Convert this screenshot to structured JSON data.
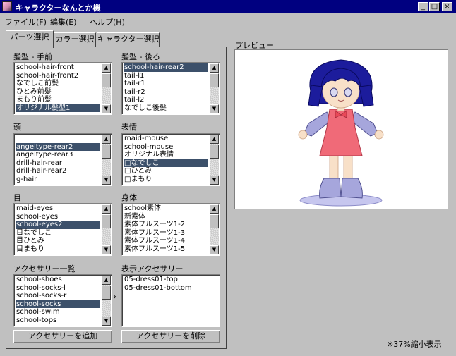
{
  "window": {
    "title": "キャラクターなんとか機",
    "minimize_glyph": "_",
    "maximize_glyph": "□",
    "close_glyph": "×"
  },
  "menu": [
    "ファイル(F)",
    "編集(E)",
    "ヘルプ(H)"
  ],
  "tabs": [
    "パーツ選択",
    "カラー選択",
    "キャラクター選択"
  ],
  "groups": {
    "front_hair": {
      "label": "髪型 - 手前",
      "items": [
        "school-hair-front",
        "school-hair-front2",
        "なでしこ前髪",
        "ひとみ前髪",
        "まもり前髪",
        "オリジナル髪型1"
      ],
      "selected": 5
    },
    "rear_hair": {
      "label": "髪型 - 後ろ",
      "items": [
        "school-hair-rear2",
        "tail-l1",
        "tail-r1",
        "tail-r2",
        "tail-l2",
        "なでしこ後髪"
      ],
      "selected": 0
    },
    "head": {
      "label": "頭",
      "items": [
        "",
        "angeltype-rear2",
        "angeltype-rear3",
        "drill-hair-rear",
        "drill-hair-rear2",
        "g-hair"
      ],
      "selected": 1
    },
    "expression": {
      "label": "表情",
      "items": [
        "maid-mouse",
        "school-mouse",
        "オリジナル表情",
        "□なでしこ",
        "□ひとみ",
        "□まもり"
      ],
      "selected": 3
    },
    "eyes": {
      "label": "目",
      "items": [
        "maid-eyes",
        "school-eyes",
        "school-eyes2",
        "目なでしこ",
        "目ひとみ",
        "目まもり"
      ],
      "selected": 2
    },
    "body": {
      "label": "身体",
      "items": [
        "school素体",
        "新素体",
        "素体フルスーツ1-2",
        "素体フルスーツ1-3",
        "素体フルスーツ1-4",
        "素体フルスーツ1-5"
      ],
      "selected": -1
    },
    "accessories": {
      "label": "アクセサリー一覧",
      "items": [
        "school-shoes",
        "school-socks-l",
        "school-socks-r",
        "school-socks",
        "school-swim",
        "school-tops"
      ],
      "selected": 3
    },
    "shown_accessories": {
      "label": "表示アクセサリー",
      "items": [
        "05-dress01-top",
        "05-dress01-bottom"
      ],
      "selected": -1
    }
  },
  "transfer_arrow": "›",
  "buttons": {
    "add_accessory": "アクセサリーを追加",
    "remove_accessory": "アクセサリーを削除"
  },
  "preview": {
    "label": "プレビュー",
    "scale_note": "※37%縮小表示"
  },
  "colors": {
    "titlebar": "#000080",
    "selection": "#3c506a",
    "hair": "#1c1c9c",
    "dress": "#f06a78",
    "sleeve": "#a6a6dc"
  }
}
